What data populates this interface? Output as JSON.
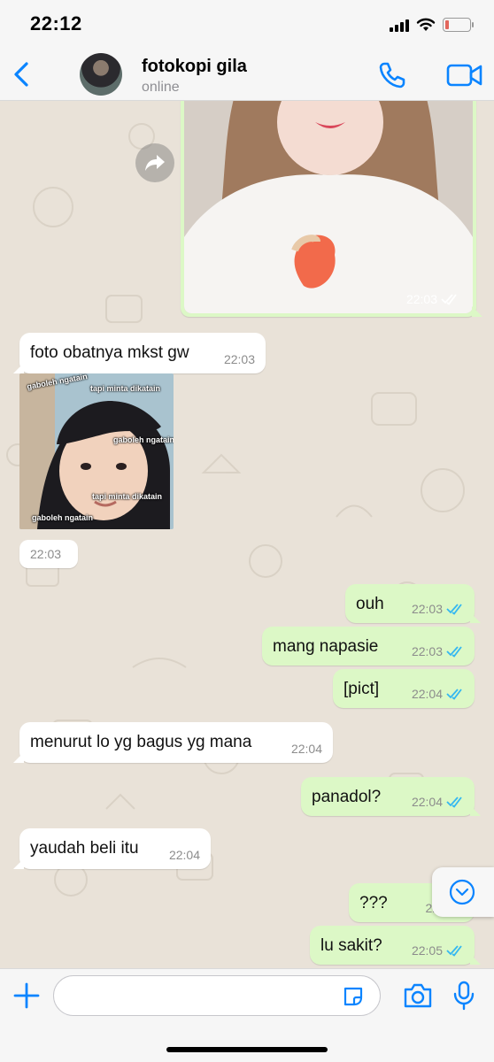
{
  "status_bar": {
    "time": "22:12",
    "icons": [
      "signal-icon",
      "wifi-icon",
      "battery-icon"
    ],
    "battery_level": 0.15
  },
  "header": {
    "contact_name": "fotokopi gila",
    "status": "online",
    "icons": [
      "back-icon",
      "avatar",
      "phone-icon",
      "video-icon"
    ]
  },
  "colors": {
    "accent": "#0a84ff",
    "outgoing_bubble": "#dcf8c6",
    "incoming_bubble": "#ffffff",
    "chat_bg": "#e9e2d8",
    "read_ticks": "#34b7f1"
  },
  "messages": [
    {
      "direction": "out",
      "type": "image",
      "time": "22:03",
      "status": "read"
    },
    {
      "direction": "in",
      "type": "text",
      "text": "foto obatnya mkst gw",
      "time": "22:03"
    },
    {
      "direction": "in",
      "type": "sticker",
      "sticker_text": [
        "gaboleh ngatain",
        "tapi minta dikatain",
        "gaboleh ngatain",
        "tapi minta dikatain",
        "gaboleh ngatain"
      ],
      "time": "22:03"
    },
    {
      "direction": "out",
      "type": "text",
      "text": "ouh",
      "time": "22:03",
      "status": "read"
    },
    {
      "direction": "out",
      "type": "text",
      "text": "mang napasie",
      "time": "22:03",
      "status": "read"
    },
    {
      "direction": "out",
      "type": "text",
      "text": "[pict]",
      "time": "22:04",
      "status": "read"
    },
    {
      "direction": "in",
      "type": "text",
      "text": "menurut lo yg bagus yg mana",
      "time": "22:04"
    },
    {
      "direction": "out",
      "type": "text",
      "text": "panadol?",
      "time": "22:04",
      "status": "read"
    },
    {
      "direction": "in",
      "type": "text",
      "text": "yaudah beli itu",
      "time": "22:04"
    },
    {
      "direction": "out",
      "type": "text",
      "text": "???",
      "time": "22:",
      "status": "read"
    },
    {
      "direction": "out",
      "type": "text",
      "text": "lu sakit?",
      "time": "22:05",
      "status": "read"
    }
  ],
  "input": {
    "placeholder": "",
    "icons": [
      "plus-icon",
      "sticker-icon",
      "camera-icon",
      "microphone-icon"
    ]
  },
  "scroll_button_icon": "chevron-down-icon",
  "forward_icon": "forward-icon"
}
